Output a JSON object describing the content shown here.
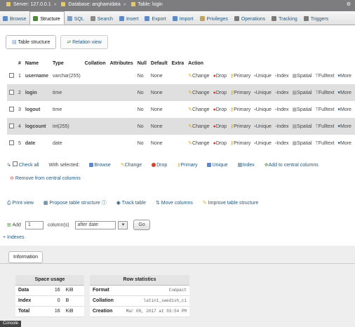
{
  "breadcrumb": {
    "server": "Server: 127.0.0.1",
    "database": "Database: anghamidata",
    "table": "Table: login"
  },
  "topmenu": [
    {
      "label": "Browse",
      "icon": "browse-icon",
      "active": false,
      "color": "#5c8ac9"
    },
    {
      "label": "Structure",
      "icon": "structure-icon",
      "active": true,
      "color": "#4a8c3a"
    },
    {
      "label": "SQL",
      "icon": "sql-icon",
      "active": false,
      "color": "#7fa0c4"
    },
    {
      "label": "Search",
      "icon": "search-icon",
      "active": false,
      "color": "#8a8a8a"
    },
    {
      "label": "Insert",
      "icon": "insert-icon",
      "active": false,
      "color": "#5c8ac9"
    },
    {
      "label": "Export",
      "icon": "export-icon",
      "active": false,
      "color": "#5c8ac9"
    },
    {
      "label": "Import",
      "icon": "import-icon",
      "active": false,
      "color": "#5c8ac9"
    },
    {
      "label": "Privileges",
      "icon": "privileges-icon",
      "active": false,
      "color": "#c4a25c"
    },
    {
      "label": "Operations",
      "icon": "operations-icon",
      "active": false,
      "color": "#7a7a7a"
    },
    {
      "label": "Tracking",
      "icon": "tracking-icon",
      "active": false,
      "color": "#7a7a7a"
    },
    {
      "label": "Triggers",
      "icon": "triggers-icon",
      "active": false,
      "color": "#7a7a7a"
    }
  ],
  "subtabs": {
    "table_structure": "Table structure",
    "relation_view": "Relation view"
  },
  "structure": {
    "headers": [
      "#",
      "Name",
      "Type",
      "Collation",
      "Attributes",
      "Null",
      "Default",
      "Extra",
      "Action"
    ],
    "rows": [
      {
        "num": "1",
        "name": "username",
        "type": "varchar(255)",
        "collation": "",
        "attributes": "",
        "null": "No",
        "default": "None",
        "extra": ""
      },
      {
        "num": "2",
        "name": "login",
        "type": "time",
        "collation": "",
        "attributes": "",
        "null": "No",
        "default": "None",
        "extra": ""
      },
      {
        "num": "3",
        "name": "logout",
        "type": "time",
        "collation": "",
        "attributes": "",
        "null": "No",
        "default": "None",
        "extra": ""
      },
      {
        "num": "4",
        "name": "logcount",
        "type": "int(255)",
        "collation": "",
        "attributes": "",
        "null": "No",
        "default": "None",
        "extra": ""
      },
      {
        "num": "5",
        "name": "date",
        "type": "date",
        "collation": "",
        "attributes": "",
        "null": "No",
        "default": "None",
        "extra": ""
      }
    ],
    "actions": [
      "Change",
      "Drop",
      "Primary",
      "Unique",
      "Index",
      "Spatial",
      "Fulltext",
      "More"
    ]
  },
  "bulk": {
    "check_all": "Check all",
    "with_selected": "With selected:",
    "browse": "Browse",
    "change": "Change",
    "drop": "Drop",
    "primary": "Primary",
    "unique": "Unique",
    "index": "Index",
    "add_central": "Add to central columns",
    "remove_central": "Remove from central columns"
  },
  "links": {
    "print_view": "Print view",
    "propose": "Propose table structure",
    "track_table": "Track table",
    "move_columns": "Move columns",
    "improve": "Improve table structure"
  },
  "add": {
    "label": "Add",
    "count": "1",
    "suffix": "column(s)",
    "position": "after date",
    "go": "Go"
  },
  "indexes_label": "Indexes",
  "information": {
    "button": "Information",
    "space": {
      "title": "Space usage",
      "rows": [
        {
          "k": "Data",
          "v": "16",
          "u": "KiB"
        },
        {
          "k": "Index",
          "v": "0",
          "u": "B"
        },
        {
          "k": "Total",
          "v": "16",
          "u": "KiB"
        }
      ]
    },
    "rowstats": {
      "title": "Row statistics",
      "rows": [
        {
          "k": "Format",
          "v": "Compact"
        },
        {
          "k": "Collation",
          "v": "latin1_swedish_ci"
        },
        {
          "k": "Creation",
          "v": "Mar 08, 2017 at 03:54 PM"
        }
      ]
    }
  },
  "console_label": "Console"
}
